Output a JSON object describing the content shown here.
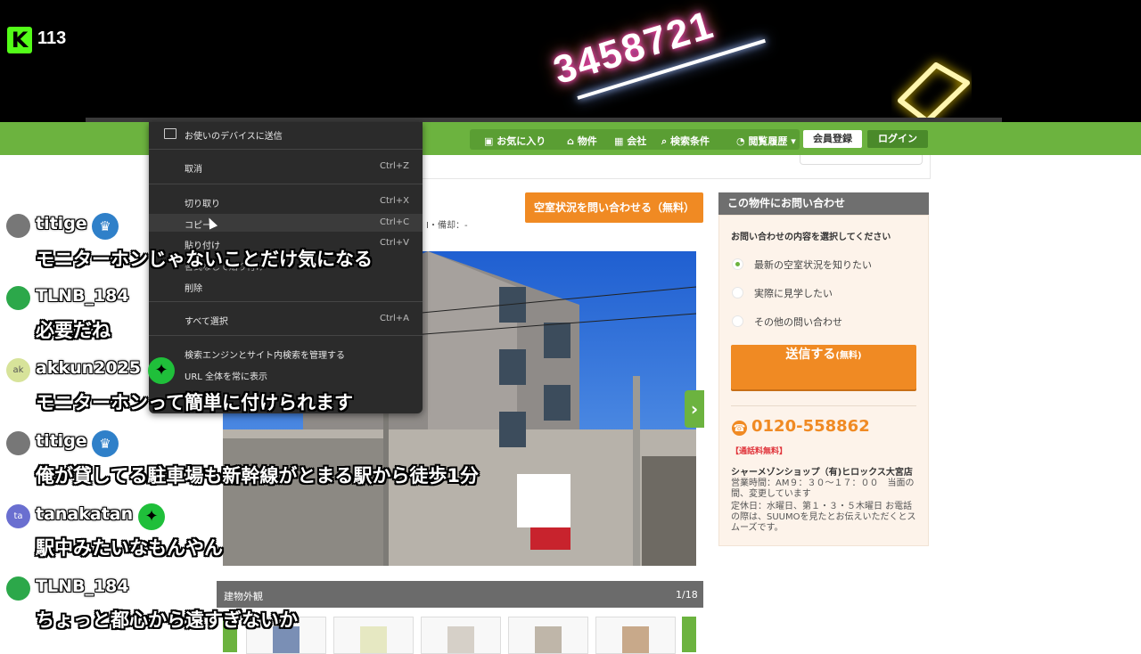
{
  "stream": {
    "viewer_count": "113",
    "kick_logo": "K",
    "neon_number": "3458721"
  },
  "site": {
    "nav": [
      "お気に入り",
      "物件",
      "会社",
      "検索条件",
      "閲覧履歴"
    ],
    "member_register": "会員登録",
    "login": "ログイン",
    "vacancy_button": "空室状況を問い合わせる（無料）",
    "info_text": "I・備却：-",
    "photo_caption": "建物外観",
    "photo_count": "1/18",
    "photo_next": "›"
  },
  "sidebar": {
    "header": "この物件にお問い合わせ",
    "prompt": "お問い合わせの内容を選択してください",
    "options": [
      "最新の空室状況を知りたい",
      "実際に見学したい",
      "その他の問い合わせ"
    ],
    "send_main": "送信する",
    "send_sub": "(無料)",
    "phone": "0120-558862",
    "free_call": "【通話料無料】",
    "shop": "シャーメゾンショップ（有)ヒロックス大宮店",
    "hours": "営業時間：AM９：３０～１７：００　当面の間、変更しています",
    "holiday": "定休日：水曜日、第１・３・５木曜日 お電話の際は、SUUMOを見たとお伝えいただくとスムーズです。"
  },
  "context_menu": {
    "send_to_device": "お使いのデバイスに送信",
    "undo": "取消",
    "undo_sc": "Ctrl+Z",
    "cut": "切り取り",
    "cut_sc": "Ctrl+X",
    "copy": "コピー",
    "copy_sc": "Ctrl+C",
    "paste": "貼り付け",
    "paste_sc": "Ctrl+V",
    "paste_plain": "書式なしで貼り付け",
    "delete": "削除",
    "select_all": "すべて選択",
    "select_all_sc": "Ctrl+A",
    "manage_search": "検索エンジンとサイト内検索を管理する",
    "show_full_url": "URL 全体を常に表示"
  },
  "chat": [
    {
      "user": "titige",
      "badge": "crown",
      "message": "モニターホンじゃないことだけ気になる"
    },
    {
      "user": "TLNB_184",
      "badge": "",
      "message": "必要だね"
    },
    {
      "user": "akkun2025",
      "badge": "star",
      "avatar_text": "ak",
      "message": "モニターホンって簡単に付けられます"
    },
    {
      "user": "titige",
      "badge": "crown",
      "message": "俺が貸してる駐車場も新幹線がとまる駅から徒歩1分"
    },
    {
      "user": "tanakatan",
      "badge": "star",
      "avatar_text": "ta",
      "message": "駅中みたいなもんやん"
    },
    {
      "user": "TLNB_184",
      "badge": "",
      "message": "ちょっと都心から遠すぎないか"
    }
  ],
  "colors": {
    "suumo_green": "#6cb33f",
    "accent_orange": "#f08a23",
    "kick_green": "#53fc18"
  }
}
